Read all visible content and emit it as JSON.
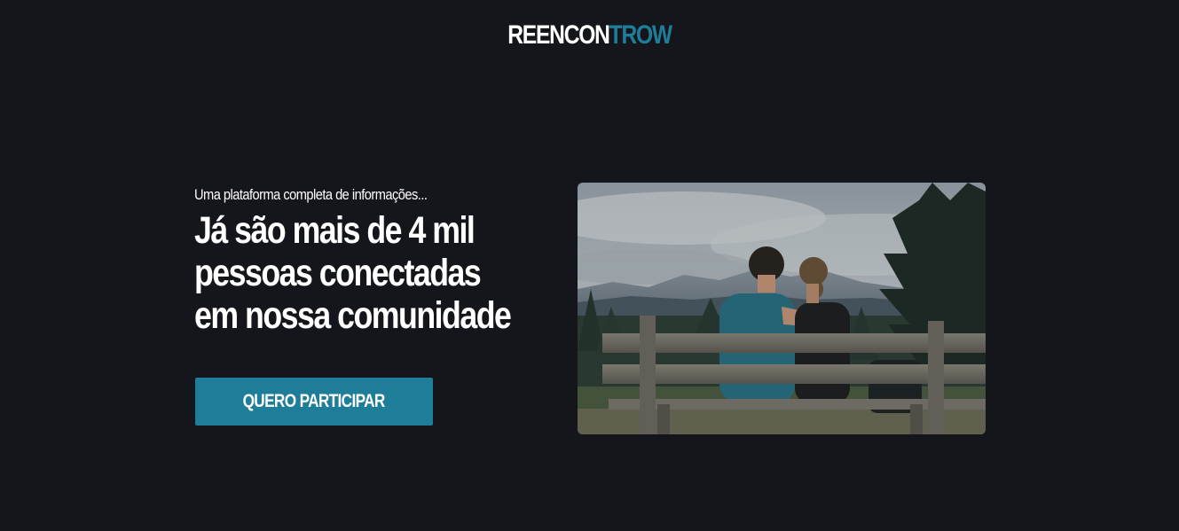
{
  "header": {
    "logo_part_a": "REENCON",
    "logo_part_b": "TROW"
  },
  "hero": {
    "subtitle": "Uma plataforma completa de informações...",
    "headline_lines": [
      "Já são mais de 4 mil",
      "pessoas conectadas",
      "em nossa comunidade"
    ],
    "cta_label": "QUERO PARTICIPAR"
  },
  "colors": {
    "background": "#14161b",
    "accent": "#1e7d99",
    "text": "#ffffff"
  }
}
